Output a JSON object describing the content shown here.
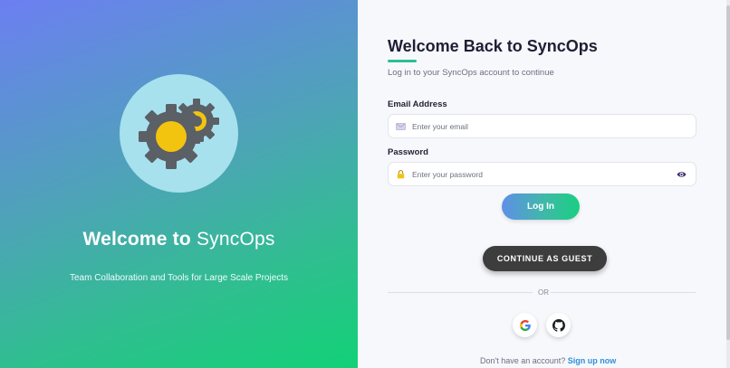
{
  "hero": {
    "title_prefix": "Welcome to ",
    "title_brand": "SyncOps",
    "subtitle": "Team Collaboration and Tools for Large Scale Projects",
    "illustration_icon": "gears-icon"
  },
  "form": {
    "title": "Welcome Back to SyncOps",
    "subtitle": "Log in to your SyncOps account to continue",
    "email": {
      "label": "Email Address",
      "placeholder": "Enter your email",
      "value": "",
      "icon": "envelope-icon"
    },
    "password": {
      "label": "Password",
      "placeholder": "Enter your password",
      "value": "",
      "icon": "lock-icon",
      "toggle_icon": "eye-icon"
    },
    "login_label": "Log In",
    "guest_label": "CONTINUE AS GUEST",
    "divider_label": "OR",
    "social": [
      {
        "name": "google",
        "icon": "google-icon"
      },
      {
        "name": "github",
        "icon": "github-icon"
      }
    ],
    "signup_prompt": "Don't have an account? ",
    "signup_link": "Sign up now"
  },
  "colors": {
    "accent_green": "#2bbf95",
    "link_blue": "#2f8fdc",
    "guest_button": "#3d3d3d",
    "hero_gradient_start": "#6c7ff2",
    "hero_gradient_end": "#12d177"
  }
}
